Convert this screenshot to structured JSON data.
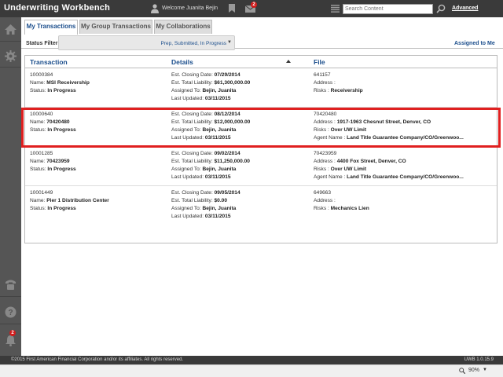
{
  "header": {
    "title": "Underwriting Workbench",
    "welcome": "Welcome Juanita Bejin",
    "mail_count": "2",
    "search_placeholder": "Search Content",
    "advanced_label": "Advanced"
  },
  "sidebar": {
    "bell_count": "2"
  },
  "tabs": [
    "My Transactions",
    "My Group Transactions",
    "My Collaborations"
  ],
  "filter": {
    "label": "Status Filter:",
    "value": "Prep, Submitted, In Progress",
    "assigned_link": "Assigned to Me"
  },
  "table": {
    "headers": [
      "Transaction",
      "Details",
      "File"
    ],
    "rows": [
      {
        "id": "10000384",
        "name_label": "Name:",
        "name": "MSI Receivership",
        "status_label": "Status:",
        "status": "In Progress",
        "closing_label": "Est. Closing Date:",
        "closing": "07/29/2014",
        "liability_label": "Est. Total Liability:",
        "liability": "$61,300,000.00",
        "assigned_label": "Assigned To:",
        "assigned": "Bejin, Juanita",
        "updated_label": "Last Updated:",
        "updated": "03/11/2015",
        "file": "641157",
        "address_label": "Address :",
        "address": "",
        "risks_label": "Risks :",
        "risks": "Receivership",
        "agent_label": "",
        "agent": ""
      },
      {
        "id": "10000640",
        "name_label": "Name:",
        "name": "70420480",
        "status_label": "Status:",
        "status": "In Progress",
        "closing_label": "Est. Closing Date:",
        "closing": "08/12/2014",
        "liability_label": "Est. Total Liability:",
        "liability": "$12,000,000.00",
        "assigned_label": "Assigned To:",
        "assigned": "Bejin, Juanita",
        "updated_label": "Last Updated:",
        "updated": "03/11/2015",
        "file": "70420480",
        "address_label": "Address :",
        "address": "1917-1963 Chesnut Street, Denver, CO",
        "risks_label": "Risks :",
        "risks": "Over UW Limit",
        "agent_label": "Agent Name :",
        "agent": "Land Title Guarantee Company/CO/Greenwoo..."
      },
      {
        "id": "10001285",
        "name_label": "Name:",
        "name": "70423959",
        "status_label": "Status:",
        "status": "In Progress",
        "closing_label": "Est. Closing Date:",
        "closing": "09/02/2014",
        "liability_label": "Est. Total Liability:",
        "liability": "$11,250,000.00",
        "assigned_label": "Assigned To:",
        "assigned": "Bejin, Juanita",
        "updated_label": "Last Updated:",
        "updated": "03/11/2015",
        "file": "70423959",
        "address_label": "Address :",
        "address": "4400 Fox Street, Denver, CO",
        "risks_label": "Risks :",
        "risks": "Over UW Limit",
        "agent_label": "Agent Name :",
        "agent": "Land Title Guarantee Company/CO/Greenwoo..."
      },
      {
        "id": "10001449",
        "name_label": "Name:",
        "name": "Pier 1 Distribution Center",
        "status_label": "Status:",
        "status": "In Progress",
        "closing_label": "Est. Closing Date:",
        "closing": "09/05/2014",
        "liability_label": "Est. Total Liability:",
        "liability": "$0.00",
        "assigned_label": "Assigned To:",
        "assigned": "Bejin, Juanita",
        "updated_label": "Last Updated:",
        "updated": "03/11/2015",
        "file": "649663",
        "address_label": "Address :",
        "address": "",
        "risks_label": "Risks :",
        "risks": "Mechanics Lien",
        "agent_label": "",
        "agent": ""
      }
    ]
  },
  "footer": {
    "copyright": "©2015 First American Financial Corporation and/or its affiliates. All rights reserved.",
    "version": "UWB 1.0.15.9"
  },
  "statusbar": {
    "zoom": "90%"
  },
  "colors": {
    "accent": "#1b4e8c",
    "header_bg": "#3a3a3a",
    "sidebar_bg": "#555555",
    "highlight": "#e02020",
    "badge": "#d21c1c"
  }
}
